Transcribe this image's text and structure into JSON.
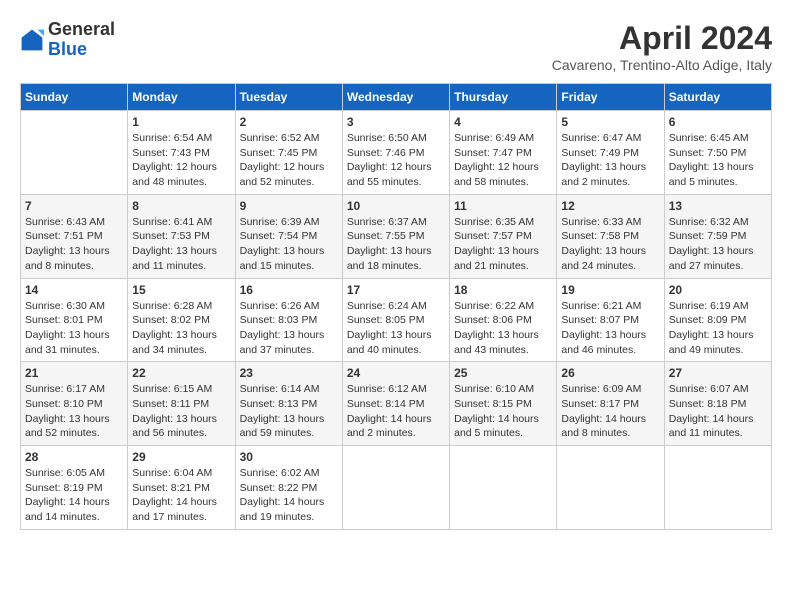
{
  "header": {
    "logo": {
      "general": "General",
      "blue": "Blue"
    },
    "title": "April 2024",
    "location": "Cavareno, Trentino-Alto Adige, Italy"
  },
  "weekdays": [
    "Sunday",
    "Monday",
    "Tuesday",
    "Wednesday",
    "Thursday",
    "Friday",
    "Saturday"
  ],
  "weeks": [
    [
      {
        "day": null
      },
      {
        "day": 1,
        "sunrise": "6:54 AM",
        "sunset": "7:43 PM",
        "daylight": "12 hours and 48 minutes."
      },
      {
        "day": 2,
        "sunrise": "6:52 AM",
        "sunset": "7:45 PM",
        "daylight": "12 hours and 52 minutes."
      },
      {
        "day": 3,
        "sunrise": "6:50 AM",
        "sunset": "7:46 PM",
        "daylight": "12 hours and 55 minutes."
      },
      {
        "day": 4,
        "sunrise": "6:49 AM",
        "sunset": "7:47 PM",
        "daylight": "12 hours and 58 minutes."
      },
      {
        "day": 5,
        "sunrise": "6:47 AM",
        "sunset": "7:49 PM",
        "daylight": "13 hours and 2 minutes."
      },
      {
        "day": 6,
        "sunrise": "6:45 AM",
        "sunset": "7:50 PM",
        "daylight": "13 hours and 5 minutes."
      }
    ],
    [
      {
        "day": 7,
        "sunrise": "6:43 AM",
        "sunset": "7:51 PM",
        "daylight": "13 hours and 8 minutes."
      },
      {
        "day": 8,
        "sunrise": "6:41 AM",
        "sunset": "7:53 PM",
        "daylight": "13 hours and 11 minutes."
      },
      {
        "day": 9,
        "sunrise": "6:39 AM",
        "sunset": "7:54 PM",
        "daylight": "13 hours and 15 minutes."
      },
      {
        "day": 10,
        "sunrise": "6:37 AM",
        "sunset": "7:55 PM",
        "daylight": "13 hours and 18 minutes."
      },
      {
        "day": 11,
        "sunrise": "6:35 AM",
        "sunset": "7:57 PM",
        "daylight": "13 hours and 21 minutes."
      },
      {
        "day": 12,
        "sunrise": "6:33 AM",
        "sunset": "7:58 PM",
        "daylight": "13 hours and 24 minutes."
      },
      {
        "day": 13,
        "sunrise": "6:32 AM",
        "sunset": "7:59 PM",
        "daylight": "13 hours and 27 minutes."
      }
    ],
    [
      {
        "day": 14,
        "sunrise": "6:30 AM",
        "sunset": "8:01 PM",
        "daylight": "13 hours and 31 minutes."
      },
      {
        "day": 15,
        "sunrise": "6:28 AM",
        "sunset": "8:02 PM",
        "daylight": "13 hours and 34 minutes."
      },
      {
        "day": 16,
        "sunrise": "6:26 AM",
        "sunset": "8:03 PM",
        "daylight": "13 hours and 37 minutes."
      },
      {
        "day": 17,
        "sunrise": "6:24 AM",
        "sunset": "8:05 PM",
        "daylight": "13 hours and 40 minutes."
      },
      {
        "day": 18,
        "sunrise": "6:22 AM",
        "sunset": "8:06 PM",
        "daylight": "13 hours and 43 minutes."
      },
      {
        "day": 19,
        "sunrise": "6:21 AM",
        "sunset": "8:07 PM",
        "daylight": "13 hours and 46 minutes."
      },
      {
        "day": 20,
        "sunrise": "6:19 AM",
        "sunset": "8:09 PM",
        "daylight": "13 hours and 49 minutes."
      }
    ],
    [
      {
        "day": 21,
        "sunrise": "6:17 AM",
        "sunset": "8:10 PM",
        "daylight": "13 hours and 52 minutes."
      },
      {
        "day": 22,
        "sunrise": "6:15 AM",
        "sunset": "8:11 PM",
        "daylight": "13 hours and 56 minutes."
      },
      {
        "day": 23,
        "sunrise": "6:14 AM",
        "sunset": "8:13 PM",
        "daylight": "13 hours and 59 minutes."
      },
      {
        "day": 24,
        "sunrise": "6:12 AM",
        "sunset": "8:14 PM",
        "daylight": "14 hours and 2 minutes."
      },
      {
        "day": 25,
        "sunrise": "6:10 AM",
        "sunset": "8:15 PM",
        "daylight": "14 hours and 5 minutes."
      },
      {
        "day": 26,
        "sunrise": "6:09 AM",
        "sunset": "8:17 PM",
        "daylight": "14 hours and 8 minutes."
      },
      {
        "day": 27,
        "sunrise": "6:07 AM",
        "sunset": "8:18 PM",
        "daylight": "14 hours and 11 minutes."
      }
    ],
    [
      {
        "day": 28,
        "sunrise": "6:05 AM",
        "sunset": "8:19 PM",
        "daylight": "14 hours and 14 minutes."
      },
      {
        "day": 29,
        "sunrise": "6:04 AM",
        "sunset": "8:21 PM",
        "daylight": "14 hours and 17 minutes."
      },
      {
        "day": 30,
        "sunrise": "6:02 AM",
        "sunset": "8:22 PM",
        "daylight": "14 hours and 19 minutes."
      },
      {
        "day": null
      },
      {
        "day": null
      },
      {
        "day": null
      },
      {
        "day": null
      }
    ]
  ]
}
